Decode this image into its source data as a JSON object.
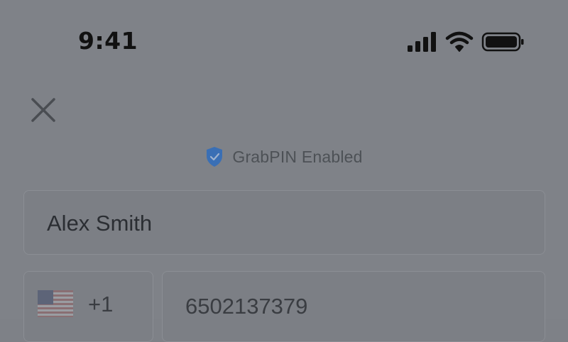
{
  "status_bar": {
    "time": "9:41",
    "icons": [
      "cellular-signal-icon",
      "wifi-icon",
      "battery-icon"
    ]
  },
  "header": {
    "close_icon": "close-icon"
  },
  "security_badge": {
    "icon": "shield-check-icon",
    "label": "GrabPIN Enabled",
    "icon_color": "#3a6fb5"
  },
  "form": {
    "name_value": "Alex Smith",
    "country": {
      "flag_icon": "us-flag-icon",
      "code": "+1"
    },
    "phone_value": "6502137379"
  },
  "colors": {
    "overlay_background": "#7f8288",
    "field_background": "#7c7f85",
    "field_border": "#8b8e94",
    "text_primary": "#2b2e33",
    "text_secondary": "#4d5156"
  }
}
